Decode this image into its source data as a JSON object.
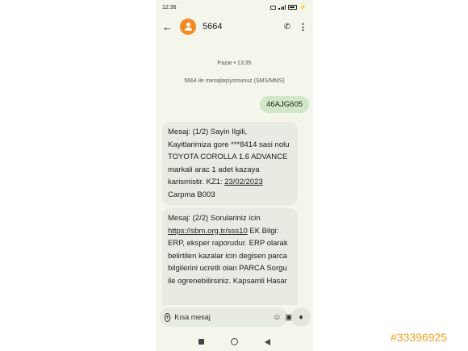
{
  "status_bar": {
    "time": "12:36"
  },
  "header": {
    "contact_name": "5664"
  },
  "conversation": {
    "date_label": "Pazar • 13:35",
    "info_label": "5664 ile mesajlaşıyorsunuz (SMS/MMS)",
    "sent_message": "46AJG605",
    "messages": [
      {
        "text_before": "Mesaj: (1/2) Sayin Ilgili, Kayitlarimiza gore ***8414 sasi nolu TOYOTA COROLLA 1.6 ADVANCE markali arac 1 adet kazaya karismistir. KZ1: ",
        "date_link": "23/02/2023",
        "text_after": " Carpma  B003"
      },
      {
        "text_before": "Mesaj: (2/2) Sorulariniz icin ",
        "url_link": "https://sbm.org.tr/sss10",
        "text_after": " EK Bilgi: ERP, eksper raporudur. ERP olarak belirtilen kazalar icin degisen parca bilgilerini ucretli olan PARCA Sorgu ile ogrenebilirsiniz. Kapsamli Hasar"
      }
    ]
  },
  "composer": {
    "placeholder": "Kısa mesaj"
  },
  "icons": {
    "back": "arrow-back-icon",
    "call": "phone-icon",
    "more": "more-vert-icon",
    "add": "add-circle-icon",
    "emoji": "emoji-icon",
    "attach": "gallery-icon",
    "voice": "voice-icon"
  },
  "colors": {
    "avatar": "#f28b24",
    "sent_bubble": "#d1e8c7",
    "received_bubble": "#e7ebe1",
    "watermark": "#f2a023"
  },
  "watermark": "#33396925"
}
